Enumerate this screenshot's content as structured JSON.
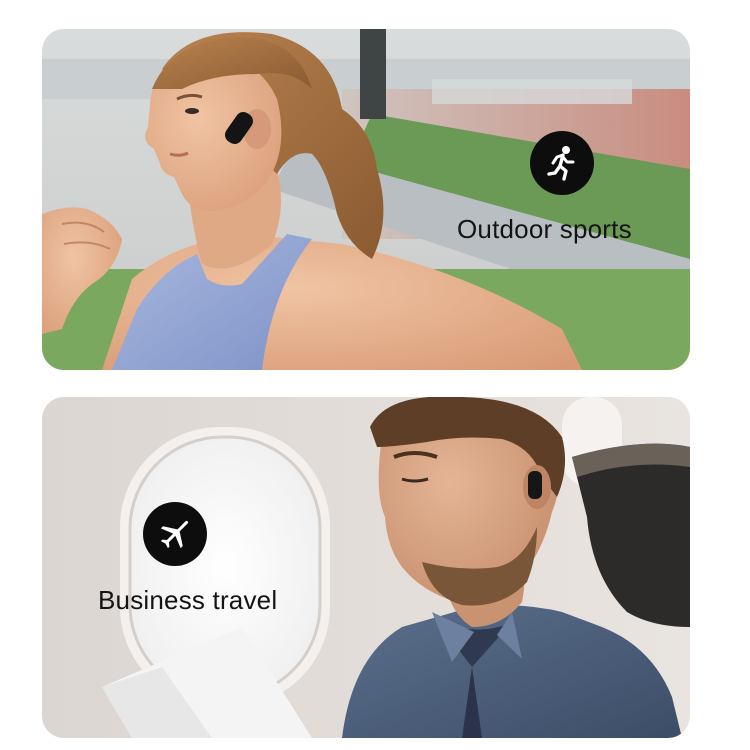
{
  "cards": [
    {
      "caption": "Outdoor sports",
      "icon": "running-person-icon"
    },
    {
      "caption": "Business travel",
      "icon": "airplane-icon"
    }
  ],
  "colors": {
    "badge": "#0d0d0d",
    "caption": "#141414",
    "background": "#ffffff"
  }
}
